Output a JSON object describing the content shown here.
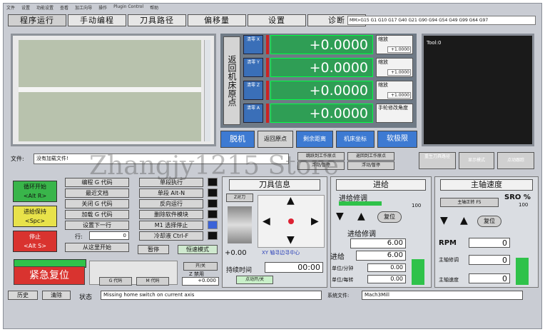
{
  "menu": [
    "文件",
    "设置",
    "功能设置",
    "查看",
    "加工向导",
    "操作",
    "Plugin Control",
    "帮助"
  ],
  "tabs": [
    "程序运行",
    "手动编程",
    "刀具路径",
    "偏移量",
    "设置",
    "诊断"
  ],
  "gcode_modes": "MM>G15  G1 G10 G17 G40 G21 G90 G94 G54 G49 G99 G64 G97",
  "dro": {
    "ref_all": "返回机床原点",
    "axes": [
      {
        "btn": "清零 X",
        "value": "+0.0000",
        "scale_label": "缩放",
        "scale": "+1.0000"
      },
      {
        "btn": "清零 Y",
        "value": "+0.0000",
        "scale_label": "缩放",
        "scale": "+1.0000"
      },
      {
        "btn": "清零 Z",
        "value": "+0.0000",
        "scale_label": "缩放",
        "scale": "+1.0000"
      },
      {
        "btn": "清零 A",
        "value": "+0.0000",
        "scale_label": "手轮修改角度",
        "scale": ""
      }
    ]
  },
  "tool_display": "Tool:0",
  "dro_buttons": [
    "脱机",
    "返回原点",
    "剩余距离",
    "机床坐标",
    "软极限"
  ],
  "file": {
    "label": "文件:",
    "value": "没有加载文件!"
  },
  "mid_buttons": [
    "跳跃到工作原点",
    "返回到工作原点",
    "浮动/暂停",
    "浮动/暂停"
  ],
  "mid_buttons_b": [
    "重生刀具路径",
    "显示模式",
    "点动跟踪"
  ],
  "cycle": {
    "start": "循环开始",
    "start_key": "<Alt R>",
    "hold": "进给保持",
    "hold_key": "<Spc>",
    "stop": "停止",
    "stop_key": "<Alt S>"
  },
  "prog_buttons": [
    "编程 G 代码",
    "最近文档",
    "关闭 G 代码",
    "加载 G 代码",
    "设置下一行"
  ],
  "line_label": "行:",
  "line_value": "0",
  "run_from": "从这里开始",
  "run_buttons": [
    "单段执行",
    "单段 Alt-N",
    "反向运行",
    "删除软件模块",
    "M1 选择停止",
    "冷却液 Ctrl-F"
  ],
  "pause": "暂停",
  "constant_velocity": "恒速模式",
  "estop": "紧急复位",
  "gcode_btn": "G 代码",
  "mcode_btn": "M 代码",
  "zinhibit_toggle": "开/关",
  "zinhibit": "Z 禁用",
  "zinhibit_value": "+0.000",
  "tool_info": {
    "title": "刀具信息",
    "tool_label": "Z对刀",
    "offset": "+0.00",
    "xy_center": "XY 轴寻边寻中心",
    "run_time_label": "持续时间",
    "run_time": "00:00",
    "jog_toggle": "点动开/关"
  },
  "feed": {
    "title": "进给",
    "override_label": "进给修调",
    "reset": "复位",
    "pct": "100",
    "feed_label": "进给修调",
    "feed_override": "6.00",
    "feed_rate_label": "进给",
    "feed_rate": "6.00",
    "units_min_label": "单位/分钟",
    "units_min": "0.00",
    "units_rev_label": "单位/每转",
    "units_rev": "0.00"
  },
  "spindle": {
    "title": "主轴速度",
    "cw": "主轴正转 F5",
    "sro_label": "SRO %",
    "sro": "100",
    "reset": "复位",
    "rpm_label": "RPM",
    "rpm": "0",
    "sov_label": "主轴修调",
    "sov": "0",
    "speed_label": "主轴速度",
    "speed": "0"
  },
  "status": {
    "history": "历史",
    "clear": "清除",
    "label": "状态",
    "message": "Missing home switch on current axis",
    "profile_label": "系统文件:",
    "profile": "Mach3Mill"
  },
  "watermark": "Zhangjy1215 Store",
  "colors": {
    "dro_green": "#2f9e55",
    "accent_blue": "#3d7ad2",
    "estop_red": "#d9332f",
    "bar_green": "#2fc24a"
  }
}
